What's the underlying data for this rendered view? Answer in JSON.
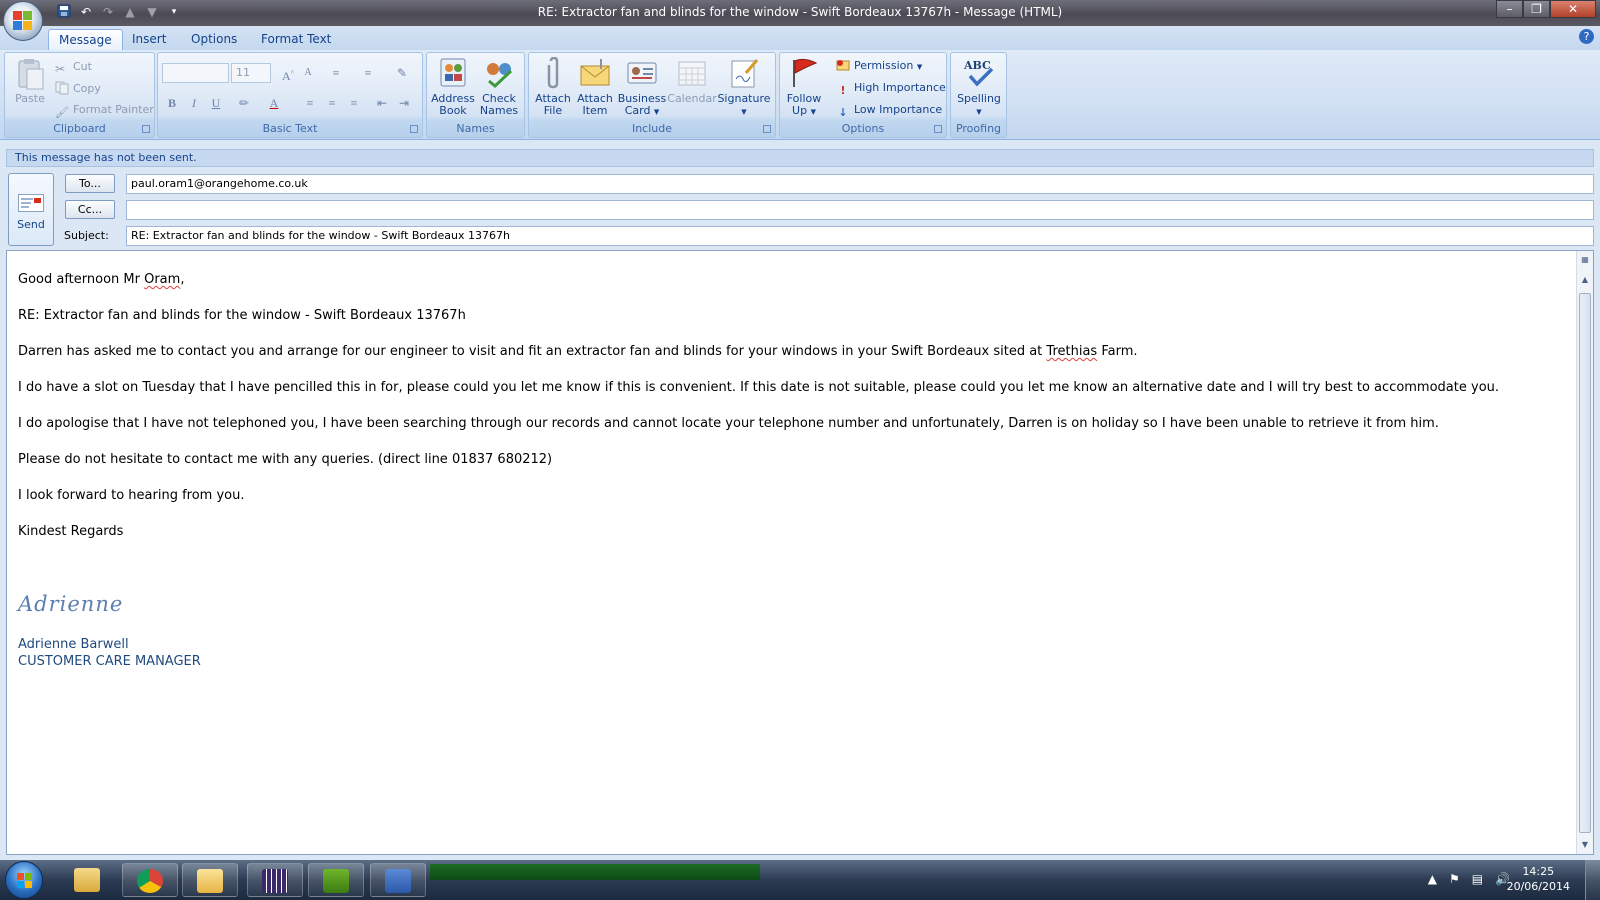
{
  "window": {
    "title": "RE: Extractor fan and blinds for the window - Swift Bordeaux 13767h  -  Message (HTML)"
  },
  "tabs": [
    "Message",
    "Insert",
    "Options",
    "Format Text"
  ],
  "ribbon": {
    "clipboard": {
      "label": "Clipboard",
      "paste": "Paste",
      "cut": "Cut",
      "copy": "Copy",
      "format_painter": "Format Painter"
    },
    "basic_text": {
      "label": "Basic Text",
      "font_size": "11",
      "bold": "B",
      "italic": "I",
      "underline": "U",
      "font_color": "A"
    },
    "names": {
      "label": "Names",
      "address_book": [
        "Address",
        "Book"
      ],
      "check_names": [
        "Check",
        "Names"
      ]
    },
    "include": {
      "label": "Include",
      "attach_file": [
        "Attach",
        "File"
      ],
      "attach_item": [
        "Attach",
        "Item"
      ],
      "business_card": [
        "Business",
        "Card"
      ],
      "calendar": "Calendar",
      "signature": "Signature"
    },
    "options": {
      "label": "Options",
      "follow_up": [
        "Follow",
        "Up"
      ],
      "permission": "Permission",
      "high_importance": "High Importance",
      "low_importance": "Low Importance"
    },
    "proofing": {
      "label": "Proofing",
      "spelling": "Spelling",
      "spelling_icon_text": "ABC"
    }
  },
  "infobar": "This message has not been sent.",
  "compose": {
    "send_label": "Send",
    "to_button": "To...",
    "cc_button": "Cc...",
    "subject_label": "Subject:",
    "to_value": "paul.oram1@orangehome.co.uk",
    "cc_value": "",
    "subject_value": "RE: Extractor fan and blinds for the window - Swift Bordeaux 13767h"
  },
  "body": {
    "greeting_pre": "Good afternoon Mr ",
    "greeting_name": "Oram",
    "greeting_post": ",",
    "re_line": "RE: Extractor fan and blinds for the window - Swift Bordeaux 13767h",
    "p1_pre": "Darren has asked me to contact you and arrange for our engineer to visit and fit an extractor fan and blinds for your windows in your Swift Bordeaux sited at ",
    "p1_place": "Trethias",
    "p1_post": " Farm.",
    "p2": "I do have a slot on Tuesday that I have pencilled this in for, please could you let me know if this is convenient.  If this date is not suitable, please could you let me know an alternative date and I will try best to accommodate you.",
    "p3": "I do apologise that I have not telephoned you, I have been searching through our records and cannot locate your telephone number and unfortunately, Darren is on holiday so I have been unable to retrieve it from him.",
    "p4": "Please do not hesitate to contact me with any queries. (direct line 01837 680212)",
    "p5": "I look forward to hearing from you.",
    "closing": "Kindest Regards",
    "signature_script": "Adrienne",
    "signature_name": "Adrienne Barwell",
    "signature_title": "CUSTOMER CARE MANAGER"
  },
  "taskbar": {
    "time": "14:25",
    "date": "20/06/2014",
    "apps": [
      "windows-explorer",
      "chrome",
      "outlook",
      "calendar-app",
      "sage",
      "word"
    ]
  },
  "colors": {
    "ribbon_bg": "#d1e0f3",
    "accent_text": "#15428b",
    "signature": "#1f497d",
    "taskbar": "#2c3b52"
  }
}
